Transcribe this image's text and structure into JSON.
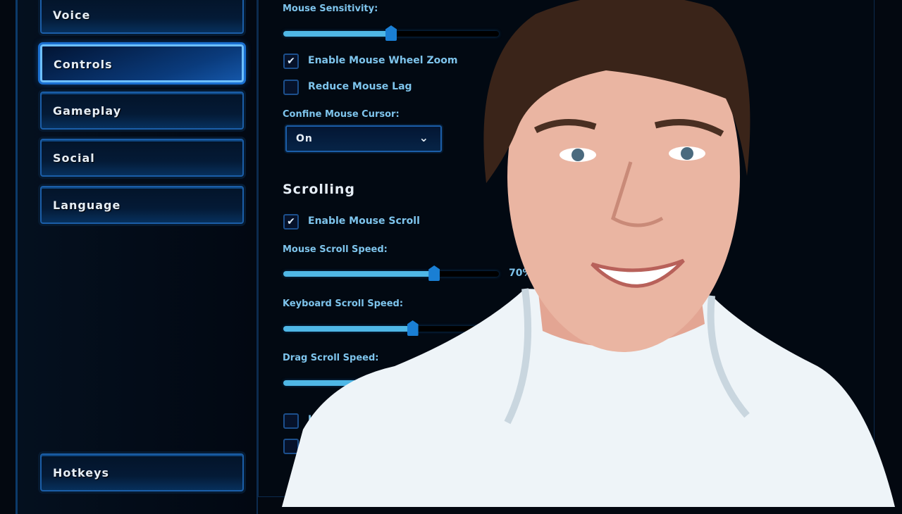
{
  "nav": {
    "items": [
      {
        "label": "Voice",
        "active": false
      },
      {
        "label": "Controls",
        "active": true
      },
      {
        "label": "Gameplay",
        "active": false
      },
      {
        "label": "Social",
        "active": false
      },
      {
        "label": "Language",
        "active": false
      }
    ],
    "hotkeys": "Hotkeys"
  },
  "mouse": {
    "sensitivity_label": "Mouse Sensitivity:",
    "sensitivity_value": 50,
    "wheel_zoom": {
      "label": "Enable Mouse Wheel Zoom",
      "checked": true
    },
    "reduce_lag": {
      "label": "Reduce Mouse Lag",
      "checked": false
    },
    "confine_label": "Confine Mouse Cursor:",
    "confine_value": "On"
  },
  "scrolling": {
    "title": "Scrolling",
    "enable": {
      "label": "Enable Mouse Scroll",
      "checked": true
    },
    "mouse_speed_label": "Mouse Scroll Speed:",
    "mouse_speed_value": 70,
    "mouse_speed_text": "70%",
    "keyboard_speed_label": "Keyboard Scroll Speed:",
    "keyboard_speed_value": 60,
    "drag_speed_label": "Drag Scroll Speed:",
    "option1": {
      "label": "In",
      "checked": false
    },
    "option2": {
      "checked": false
    }
  },
  "colors": {
    "accent": "#1a7fd4",
    "label": "#7ec4ec",
    "fill": "#4fb7e6"
  }
}
